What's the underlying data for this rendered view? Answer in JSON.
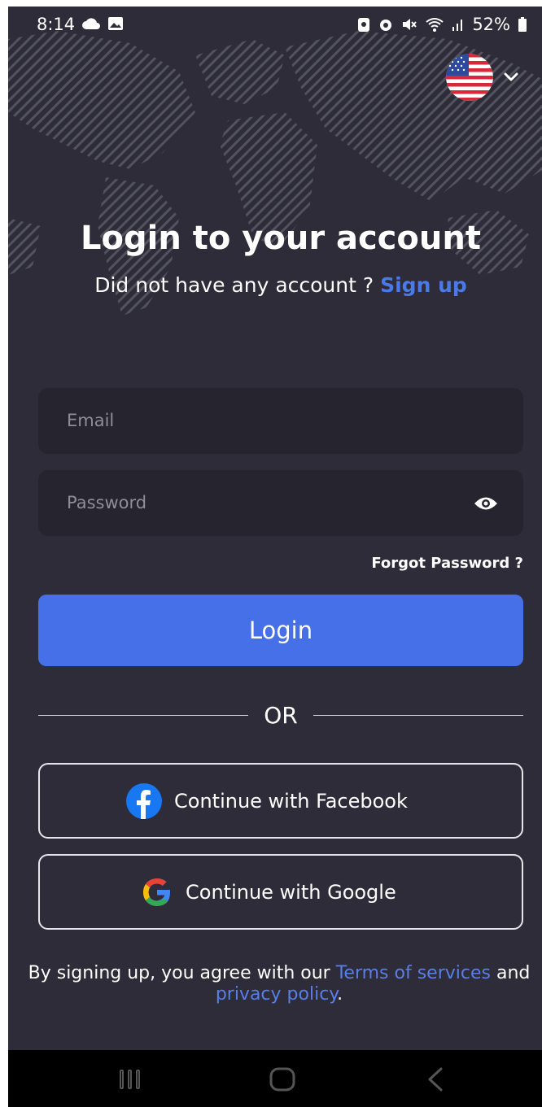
{
  "status_bar": {
    "time": "8:14",
    "battery": "52%",
    "left_icons": [
      "cloud-icon",
      "image-icon"
    ],
    "right_icons": [
      "battery-saver-icon",
      "alarm-icon",
      "mute-icon",
      "wifi-icon",
      "signal-icon",
      "battery-icon"
    ]
  },
  "header": {
    "title": "Login to your account",
    "subtitle_prefix": "Did not have any account ?",
    "signup_link": "Sign up"
  },
  "form": {
    "email_placeholder": "Email",
    "password_placeholder": "Password",
    "forgot_password": "Forgot Password ?",
    "login_button": "Login"
  },
  "divider": {
    "label": "OR"
  },
  "social": {
    "facebook_label": "Continue with Facebook",
    "google_label": "Continue with Google"
  },
  "terms": {
    "prefix": "By signing up, you agree with our",
    "terms_link": "Terms of services",
    "and": "and",
    "privacy_link": "privacy policy",
    "suffix": "."
  },
  "colors": {
    "background": "#2d2c38",
    "input_bg": "#25242f",
    "accent": "#4570e8",
    "link": "#4a79e8"
  },
  "nav_icons": [
    "recent-apps-icon",
    "home-icon",
    "back-icon"
  ]
}
